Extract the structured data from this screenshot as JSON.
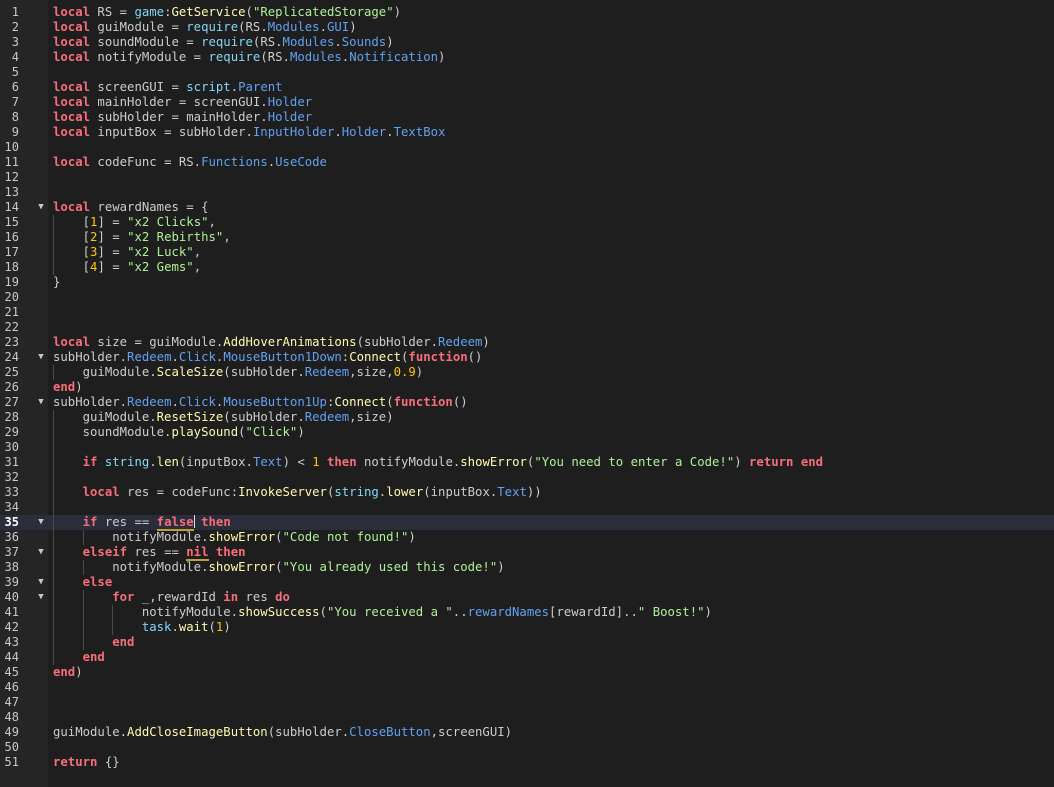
{
  "editor": {
    "language": "Lua",
    "current_line": 35,
    "fold_markers": [
      14,
      24,
      27,
      35,
      37,
      39,
      40
    ],
    "colors": {
      "background": "#1e1e1e",
      "gutter": "#252526",
      "keyword": "#f86d7c",
      "string": "#adf195",
      "number": "#ffc600",
      "property": "#61a1f1",
      "method": "#fdfbac",
      "builtin": "#84d6f7",
      "text": "#cccccc",
      "current_line": "#2a2d3a"
    },
    "lines": [
      {
        "num": "1",
        "text": "local RS = game:GetService(\"ReplicatedStorage\")"
      },
      {
        "num": "2",
        "text": "local guiModule = require(RS.Modules.GUI)"
      },
      {
        "num": "3",
        "text": "local soundModule = require(RS.Modules.Sounds)"
      },
      {
        "num": "4",
        "text": "local notifyModule = require(RS.Modules.Notification)"
      },
      {
        "num": "5",
        "text": ""
      },
      {
        "num": "6",
        "text": "local screenGUI = script.Parent"
      },
      {
        "num": "7",
        "text": "local mainHolder = screenGUI.Holder"
      },
      {
        "num": "8",
        "text": "local subHolder = mainHolder.Holder"
      },
      {
        "num": "9",
        "text": "local inputBox = subHolder.InputHolder.Holder.TextBox"
      },
      {
        "num": "10",
        "text": ""
      },
      {
        "num": "11",
        "text": "local codeFunc = RS.Functions.UseCode"
      },
      {
        "num": "12",
        "text": ""
      },
      {
        "num": "13",
        "text": ""
      },
      {
        "num": "14",
        "text": "local rewardNames = {"
      },
      {
        "num": "15",
        "text": "    [1] = \"x2 Clicks\","
      },
      {
        "num": "16",
        "text": "    [2] = \"x2 Rebirths\","
      },
      {
        "num": "17",
        "text": "    [3] = \"x2 Luck\","
      },
      {
        "num": "18",
        "text": "    [4] = \"x2 Gems\","
      },
      {
        "num": "19",
        "text": "}"
      },
      {
        "num": "20",
        "text": ""
      },
      {
        "num": "21",
        "text": ""
      },
      {
        "num": "22",
        "text": ""
      },
      {
        "num": "23",
        "text": "local size = guiModule.AddHoverAnimations(subHolder.Redeem)"
      },
      {
        "num": "24",
        "text": "subHolder.Redeem.Click.MouseButton1Down:Connect(function()"
      },
      {
        "num": "25",
        "text": "    guiModule.ScaleSize(subHolder.Redeem,size,0.9)"
      },
      {
        "num": "26",
        "text": "end)"
      },
      {
        "num": "27",
        "text": "subHolder.Redeem.Click.MouseButton1Up:Connect(function()"
      },
      {
        "num": "28",
        "text": "    guiModule.ResetSize(subHolder.Redeem,size)"
      },
      {
        "num": "29",
        "text": "    soundModule.playSound(\"Click\")"
      },
      {
        "num": "30",
        "text": ""
      },
      {
        "num": "31",
        "text": "    if string.len(inputBox.Text) < 1 then notifyModule.showError(\"You need to enter a Code!\") return end"
      },
      {
        "num": "32",
        "text": ""
      },
      {
        "num": "33",
        "text": "    local res = codeFunc:InvokeServer(string.lower(inputBox.Text))"
      },
      {
        "num": "34",
        "text": ""
      },
      {
        "num": "35",
        "text": "    if res == false then"
      },
      {
        "num": "36",
        "text": "        notifyModule.showError(\"Code not found!\")"
      },
      {
        "num": "37",
        "text": "    elseif res == nil then"
      },
      {
        "num": "38",
        "text": "        notifyModule.showError(\"You already used this code!\")"
      },
      {
        "num": "39",
        "text": "    else"
      },
      {
        "num": "40",
        "text": "        for _,rewardId in res do"
      },
      {
        "num": "41",
        "text": "            notifyModule.showSuccess(\"You received a \"..rewardNames[rewardId]..\" Boost!\")"
      },
      {
        "num": "42",
        "text": "            task.wait(1)"
      },
      {
        "num": "43",
        "text": "        end"
      },
      {
        "num": "44",
        "text": "    end"
      },
      {
        "num": "45",
        "text": "end)"
      },
      {
        "num": "46",
        "text": ""
      },
      {
        "num": "47",
        "text": ""
      },
      {
        "num": "48",
        "text": ""
      },
      {
        "num": "49",
        "text": "guiModule.AddCloseImageButton(subHolder.CloseButton,screenGUI)"
      },
      {
        "num": "50",
        "text": ""
      },
      {
        "num": "51",
        "text": "return {}"
      }
    ]
  }
}
